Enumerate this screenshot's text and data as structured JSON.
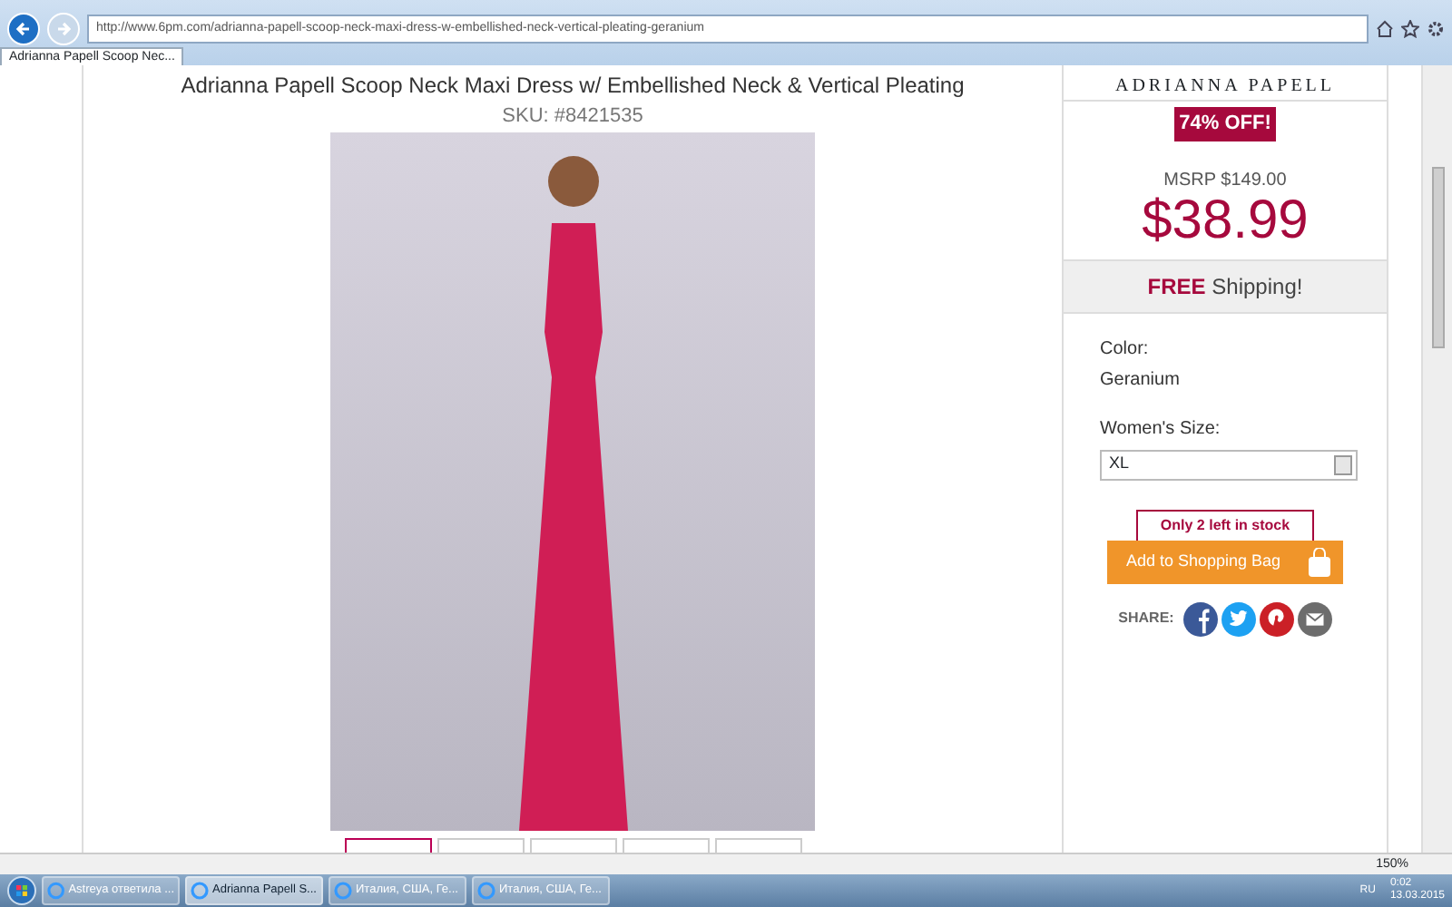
{
  "browser": {
    "address": "http://www.6pm.com/adrianna-papell-scoop-neck-maxi-dress-w-embellished-neck-vertical-pleating-geranium",
    "tab_title": "Adrianna Papell Scoop Nec...",
    "zoom": "150%"
  },
  "product": {
    "title": "Adrianna Papell Scoop Neck Maxi Dress w/ Embellished Neck & Vertical Pleating",
    "sku": "SKU: #8421535",
    "thumbnails": [
      {
        "selected": true
      },
      {
        "selected": false
      },
      {
        "selected": false
      },
      {
        "selected": false
      },
      {
        "selected": false
      }
    ]
  },
  "buy_box": {
    "brand": "ADRIANNA PAPELL",
    "discount": "74% OFF!",
    "msrp": "MSRP $149.00",
    "price": "$38.99",
    "shipping_free": "FREE",
    "shipping_rest": "Shipping!",
    "color_label": "Color:",
    "color_value": "Geranium",
    "size_label": "Women's Size:",
    "size_value": "XL",
    "stock_note": "Only 2 left in stock",
    "add_button": "Add to Shopping Bag",
    "share_label": "SHARE:"
  },
  "taskbar": {
    "items": [
      {
        "label": "Astreya ответила ...",
        "selected": false
      },
      {
        "label": "Adrianna Papell S...",
        "selected": true
      },
      {
        "label": "Италия, США, Ге...",
        "selected": false
      },
      {
        "label": "Италия, США, Ге...",
        "selected": false
      }
    ],
    "language": "RU",
    "time": "0:02",
    "date": "13.03.2015"
  }
}
